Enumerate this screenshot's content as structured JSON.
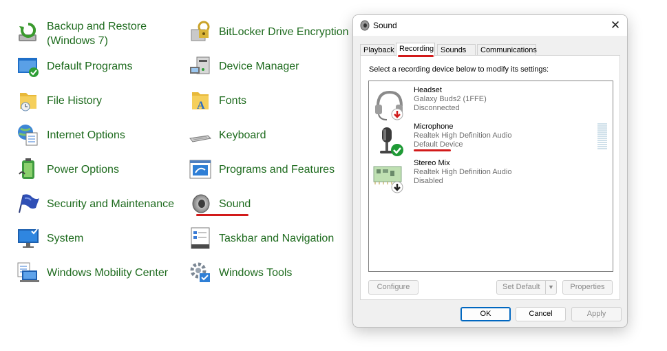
{
  "control_panel": {
    "items": [
      {
        "label": "Backup and Restore (Windows 7)",
        "icon": "backup-restore-icon"
      },
      {
        "label": "BitLocker Drive Encryption",
        "icon": "bitlocker-icon"
      },
      {
        "label": "Default Programs",
        "icon": "default-programs-icon"
      },
      {
        "label": "Device Manager",
        "icon": "device-manager-icon"
      },
      {
        "label": "File History",
        "icon": "file-history-icon"
      },
      {
        "label": "Fonts",
        "icon": "fonts-icon"
      },
      {
        "label": "Internet Options",
        "icon": "internet-options-icon"
      },
      {
        "label": "Keyboard",
        "icon": "keyboard-icon"
      },
      {
        "label": "Power Options",
        "icon": "power-options-icon"
      },
      {
        "label": "Programs and Features",
        "icon": "programs-features-icon"
      },
      {
        "label": "Security and Maintenance",
        "icon": "security-flag-icon"
      },
      {
        "label": "Sound",
        "icon": "speaker-icon"
      },
      {
        "label": "System",
        "icon": "system-monitor-icon"
      },
      {
        "label": "Taskbar and Navigation",
        "icon": "taskbar-icon"
      },
      {
        "label": "Windows Mobility Center",
        "icon": "mobility-center-icon"
      },
      {
        "label": "Windows Tools",
        "icon": "windows-tools-icon"
      }
    ],
    "link_color": "#1e6b1e",
    "highlight_color": "#d21a1a"
  },
  "dialog": {
    "title": "Sound",
    "close_glyph": "✕",
    "tabs": [
      "Playback",
      "Recording",
      "Sounds",
      "Communications"
    ],
    "active_tab": "Recording",
    "instruction": "Select a recording device below to modify its settings:",
    "devices": [
      {
        "name": "Headset",
        "description": "Galaxy Buds2 (1FFE)",
        "status": "Disconnected",
        "icon": "headset-icon",
        "badge": "red-down-arrow-badge"
      },
      {
        "name": "Microphone",
        "description": "Realtek High Definition Audio",
        "status": "Default Device",
        "icon": "microphone-icon",
        "badge": "green-check-badge"
      },
      {
        "name": "Stereo Mix",
        "description": "Realtek High Definition Audio",
        "status": "Disabled",
        "icon": "circuit-board-icon",
        "badge": "black-down-arrow-badge"
      }
    ],
    "buttons": {
      "configure": "Configure",
      "set_default": "Set Default",
      "properties": "Properties",
      "ok": "OK",
      "cancel": "Cancel",
      "apply": "Apply"
    },
    "accent_color": "#0067c0"
  }
}
